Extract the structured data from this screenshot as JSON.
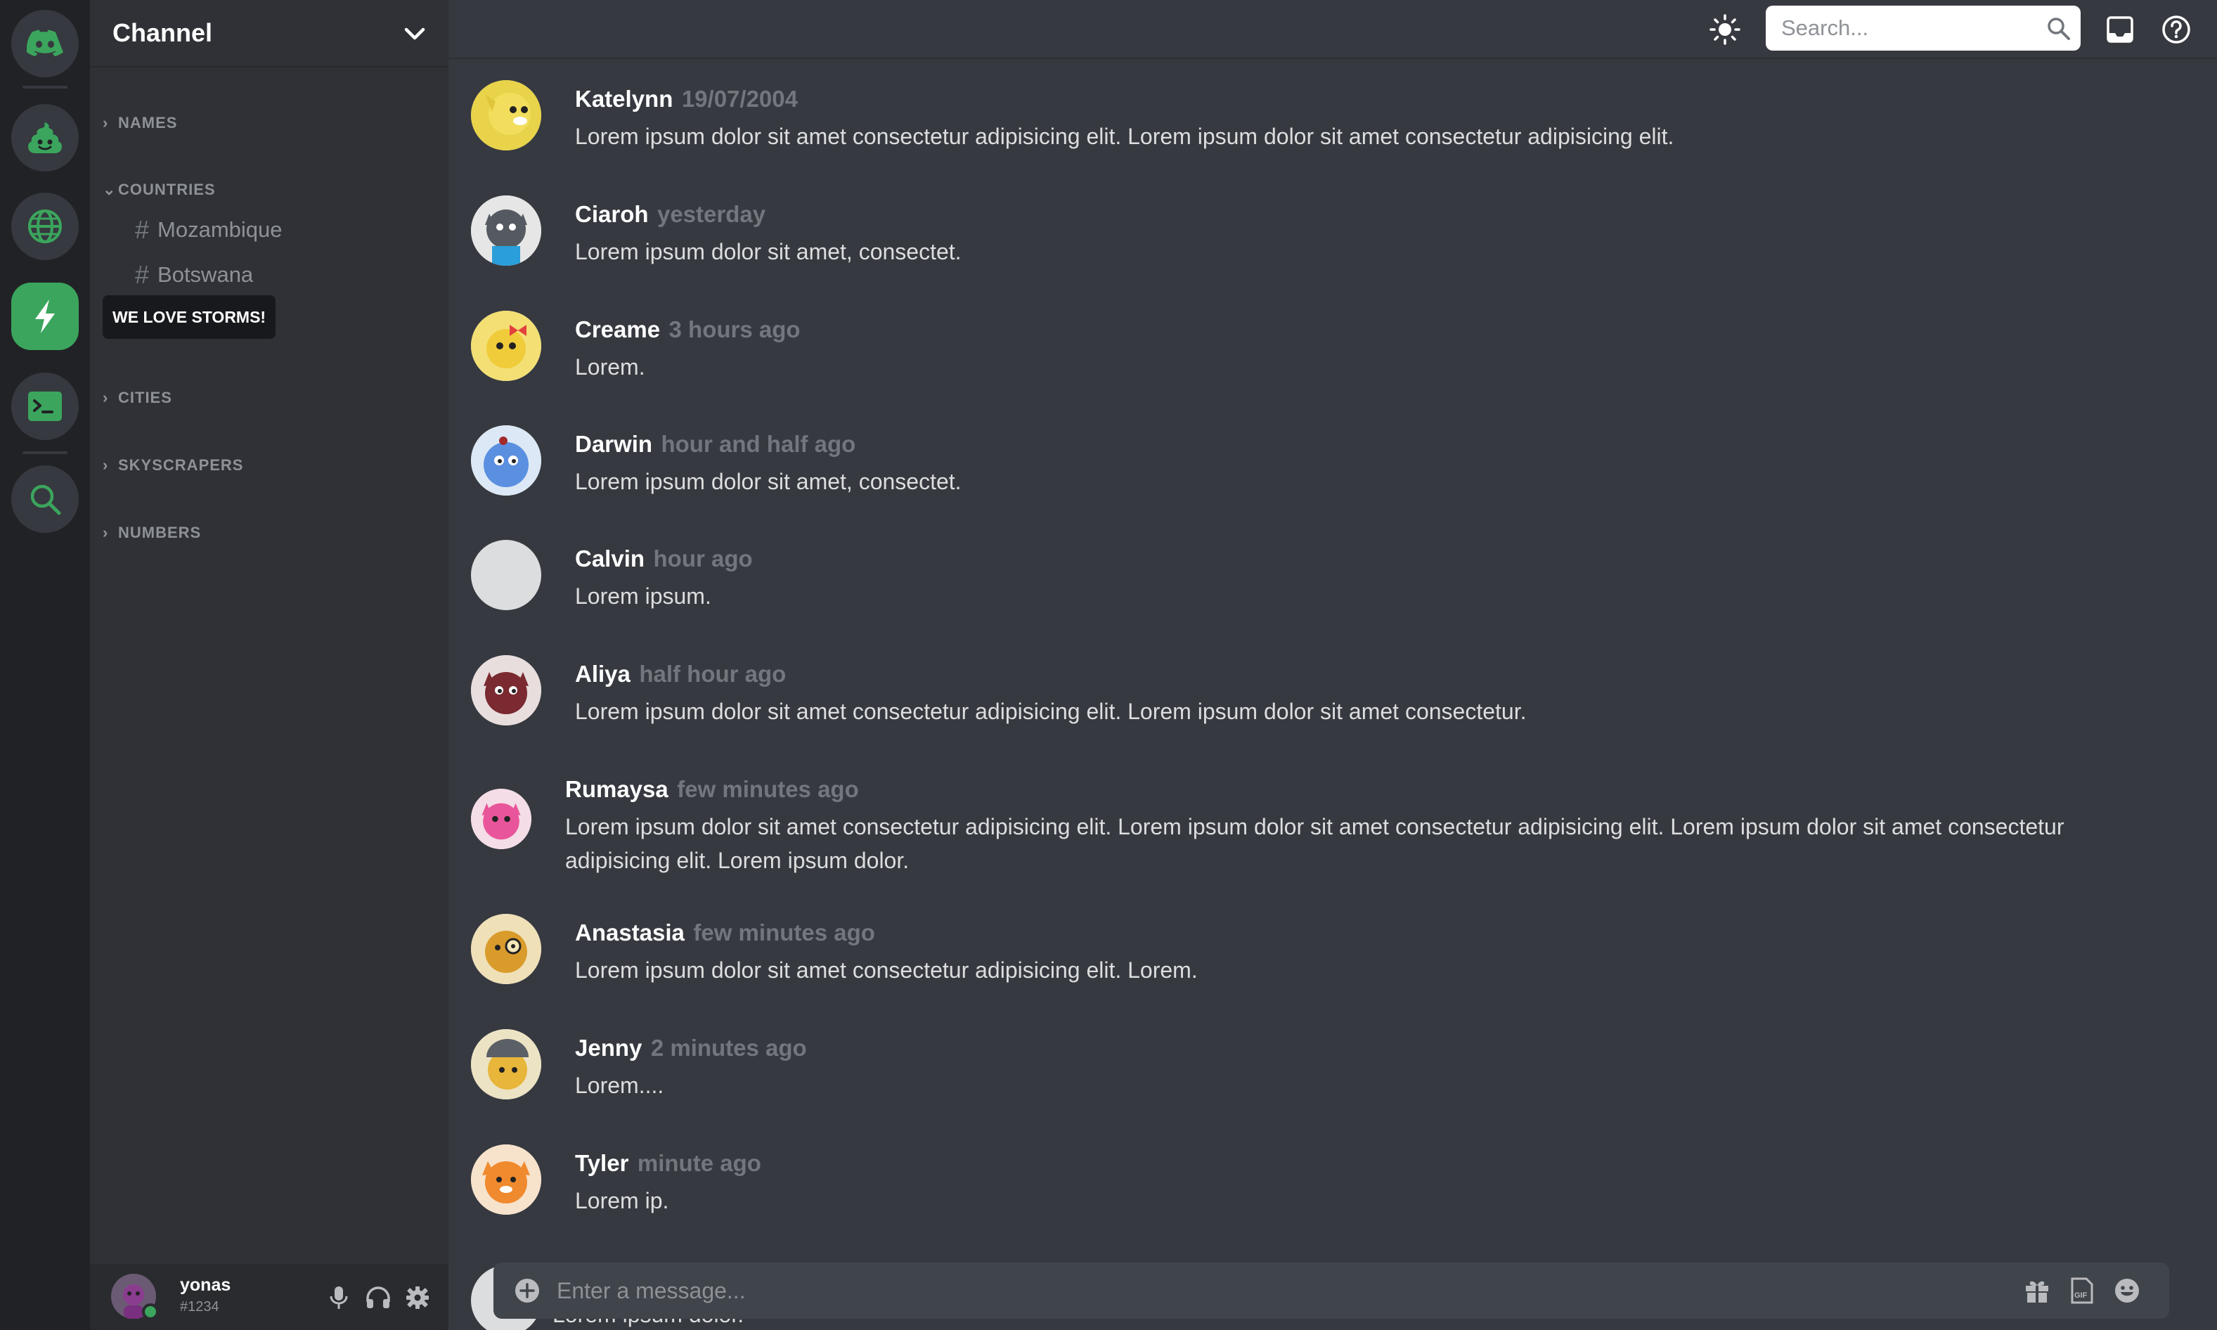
{
  "colors": {
    "accent": "#3ba55d",
    "rail_bg": "#202225",
    "sidebar_bg": "#2f3136",
    "main_bg": "#36393f",
    "muted_text": "#8e9297"
  },
  "rail": {
    "servers": [
      {
        "icon": "discord-logo-icon"
      },
      {
        "icon": "poop-icon"
      },
      {
        "icon": "globe-icon"
      },
      {
        "icon": "lightning-bolt-icon",
        "active": true
      },
      {
        "icon": "terminal-icon"
      },
      {
        "icon": "search-icon"
      }
    ]
  },
  "sidebar": {
    "title": "Channel",
    "tooltip": "WE LOVE STORMS!",
    "categories": [
      {
        "label": "NAMES",
        "expanded": false
      },
      {
        "label": "COUNTRIES",
        "expanded": true,
        "channels": [
          "Mozambique",
          "Botswana"
        ]
      },
      {
        "label": "CITIES",
        "expanded": false
      },
      {
        "label": "SKYSCRAPERS",
        "expanded": false
      },
      {
        "label": "NUMBERS",
        "expanded": false
      }
    ]
  },
  "user": {
    "name": "yonas",
    "tag": "#1234",
    "status": "online"
  },
  "topbar": {
    "search_placeholder": "Search..."
  },
  "messages": [
    {
      "author": "Katelynn",
      "time": "19/07/2004",
      "text": "Lorem ipsum dolor sit amet consectetur adipisicing elit. Lorem ipsum dolor sit amet consectetur adipisicing elit."
    },
    {
      "author": "Ciaroh",
      "time": "yesterday",
      "text": "Lorem ipsum dolor sit amet, consectet."
    },
    {
      "author": "Creame",
      "time": "3 hours ago",
      "text": "Lorem."
    },
    {
      "author": "Darwin",
      "time": "hour and half ago",
      "text": "Lorem ipsum dolor sit amet, consectet."
    },
    {
      "author": "Calvin",
      "time": "hour ago",
      "text": "Lorem ipsum."
    },
    {
      "author": "Aliya",
      "time": "half hour ago",
      "text": "Lorem ipsum dolor sit amet consectetur adipisicing elit. Lorem ipsum dolor sit amet consectetur."
    },
    {
      "author": "Rumaysa",
      "time": "few minutes ago",
      "text": "Lorem ipsum dolor sit amet consectetur adipisicing elit. Lorem ipsum dolor sit amet consectetur adipisicing elit. Lorem ipsum dolor sit amet consectetur adipisicing elit. Lorem ipsum dolor."
    },
    {
      "author": "Anastasia",
      "time": "few minutes ago",
      "text": "Lorem ipsum dolor sit amet consectetur adipisicing elit. Lorem."
    },
    {
      "author": "Jenny",
      "time": "2 minutes ago",
      "text": "Lorem...."
    },
    {
      "author": "Tyler",
      "time": "minute ago",
      "text": "Lorem ip."
    }
  ],
  "partial_message": {
    "text": "Lorem ipsum dolor."
  },
  "composer": {
    "placeholder": "Enter a message..."
  }
}
